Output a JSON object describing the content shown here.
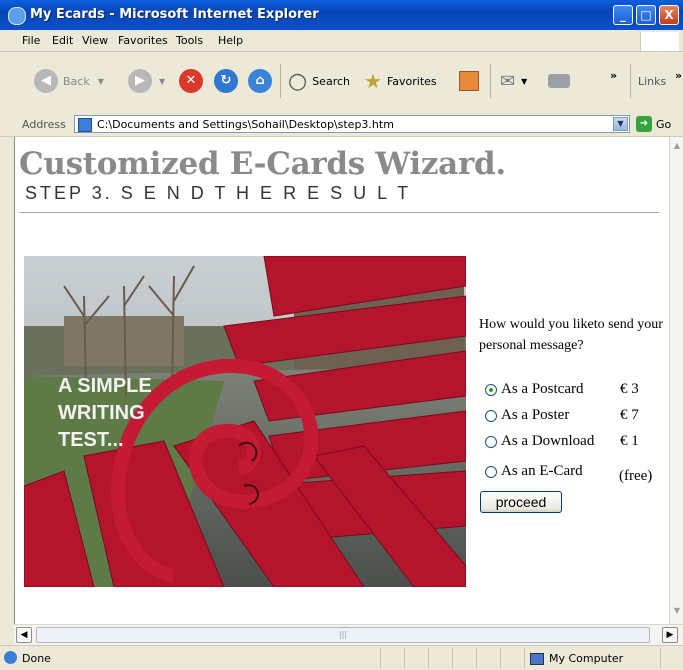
{
  "window": {
    "title": "My Ecards - Microsoft Internet Explorer",
    "minimize_label": "_",
    "maximize_label": "□",
    "close_label": "X"
  },
  "menu": [
    "File",
    "Edit",
    "View",
    "Favorites",
    "Tools",
    "Help"
  ],
  "toolbar": {
    "back_label": "Back",
    "search_label": "Search",
    "favorites_label": "Favorites",
    "chevron": "»",
    "links_label": "Links"
  },
  "address": {
    "label": "Address",
    "url": "C:\\Documents and Settings\\Sohail\\Desktop\\step3.htm",
    "go_label": "Go"
  },
  "page": {
    "title": "Customized E-Cards Wizard.",
    "subtitle": "STEP 3. S E N D   T H E   R E S U L T",
    "overlay_text": "A SIMPLE\nWRITING\nTEST...",
    "question": "How would you liketo send your personal message?",
    "options": [
      {
        "label": "As a Postcard",
        "price": "€ 3",
        "selected": true
      },
      {
        "label": "As a Poster",
        "price": "€ 7",
        "selected": false
      },
      {
        "label": "As a Download",
        "price": "€ 1",
        "selected": false
      },
      {
        "label": "As an E-Card",
        "price": "(free)",
        "selected": false
      }
    ],
    "proceed_label": "proceed"
  },
  "status": {
    "text": "Done",
    "zone": "My Computer"
  },
  "colors": {
    "title_gray": "#8a8a8a",
    "bench_red": "#b4142c",
    "xp_blue": "#0a50cc"
  }
}
